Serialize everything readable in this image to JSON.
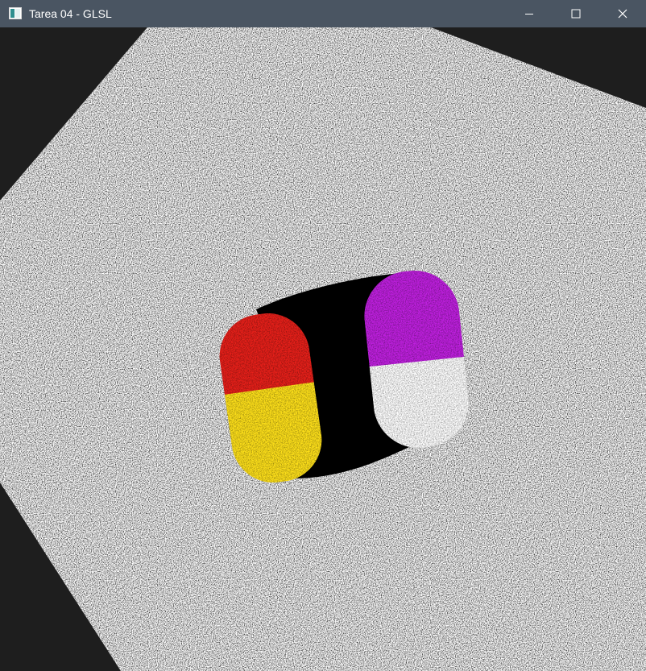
{
  "window": {
    "title": "Tarea 04 - GLSL",
    "icon": "window-app-icon",
    "controls": {
      "minimize_icon": "minimize-icon",
      "maximize_icon": "maximize-icon",
      "close_icon": "close-icon"
    }
  },
  "scene": {
    "background_color": "#1e1e1e",
    "plane_color": "#ffffff",
    "noise_color": "#000000",
    "capsule_left_colors": [
      "#e8201a",
      "#ffe11a"
    ],
    "capsule_right_colors": [
      "#c020e0",
      "#ffffff"
    ],
    "shadow_color": "#000000"
  }
}
